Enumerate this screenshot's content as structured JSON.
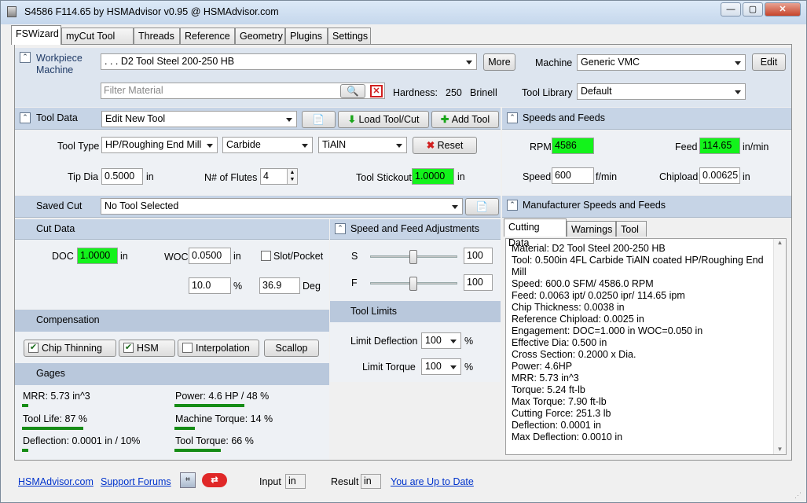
{
  "window": {
    "title": "S4586 F114.65 by HSMAdvisor v0.95 @ HSMAdvisor.com",
    "minimize": "—",
    "maximize": "▢",
    "close": "✕"
  },
  "tabs": [
    "FSWizard",
    "myCut Tool DB",
    "Threads",
    "Reference",
    "Geometry",
    "Plugins",
    "Settings"
  ],
  "workpiece": {
    "label1": "Workpiece",
    "label2": "Machine",
    "material": ". . . D2 Tool Steel 200-250 HB",
    "more": "More",
    "machine_label": "Machine",
    "machine": "Generic VMC",
    "edit": "Edit",
    "filter_placeholder": "Filter Material",
    "hardness_label": "Hardness:",
    "hardness_value": "250",
    "hardness_unit": "Brinell",
    "tool_library_label": "Tool Library",
    "tool_library": "Default"
  },
  "tool_data": {
    "header": "Tool Data",
    "tool_select": "Edit New Tool",
    "load": "Load Tool/Cut",
    "add": "Add Tool",
    "tool_type_label": "Tool Type",
    "tool_type": "HP/Roughing End Mill",
    "material": "Carbide",
    "coating": "TiAlN",
    "reset": "Reset",
    "tip_dia_label": "Tip Dia",
    "tip_dia": "0.5000",
    "tip_unit": "in",
    "flutes_label": "N# of Flutes",
    "flutes": "4",
    "stickout_label": "Tool Stickout",
    "stickout": "1.0000",
    "stickout_unit": "in"
  },
  "speeds": {
    "header": "Speeds and Feeds",
    "rpm_label": "RPM",
    "rpm": "4586",
    "feed_label": "Feed",
    "feed": "114.65",
    "feed_unit": "in/min",
    "speed_label": "Speed",
    "speed": "600",
    "speed_unit": "f/min",
    "chipload_label": "Chipload",
    "chipload": "0.00625",
    "chipload_unit": "in"
  },
  "saved_cut": {
    "label": "Saved Cut",
    "value": "No Tool Selected"
  },
  "manufacturer": {
    "header": "Manufacturer Speeds and Feeds"
  },
  "cut_data": {
    "header": "Cut Data",
    "doc_label": "DOC",
    "doc": "1.0000",
    "doc_unit": "in",
    "woc_label": "WOC",
    "woc": "0.0500",
    "woc_unit": "in",
    "slot_label": "Slot/Pocket",
    "pct": "10.0",
    "pct_unit": "%",
    "deg": "36.9",
    "deg_unit": "Deg"
  },
  "adjust": {
    "header": "Speed and Feed Adjustments",
    "s_label": "S",
    "s_value": "100",
    "s_level": 0.5,
    "f_label": "F",
    "f_value": "100",
    "f_level": 0.5
  },
  "limits": {
    "header": "Tool Limits",
    "defl_label": "Limit Deflection",
    "defl": "100",
    "defl_unit": "%",
    "torque_label": "Limit Torque",
    "torque": "100",
    "torque_unit": "%"
  },
  "compensation": {
    "header": "Compensation",
    "chip_thinning": "Chip Thinning",
    "hsm": "HSM",
    "interpolation": "Interpolation",
    "scallop": "Scallop"
  },
  "gages": {
    "header": "Gages",
    "mrr": "MRR: 5.73 in^3",
    "mrr_level": 0.06,
    "power": "Power: 4.6 HP / 48 %",
    "power_level": 0.48,
    "tool_life": "Tool Life: 87 %",
    "tool_life_level": 0.87,
    "machine_torque": "Machine Torque: 14 %",
    "machine_torque_level": 0.14,
    "deflection": "Deflection: 0.0001 in / 10%",
    "deflection_level": 0.1,
    "tool_torque": "Tool Torque: 66 %",
    "tool_torque_level": 0.66
  },
  "info_tabs": [
    "Cutting Data",
    "Warnings",
    "Tool"
  ],
  "cutting_data": [
    "Material: D2 Tool Steel 200-250 HB",
    "Tool: 0.500in 4FL Carbide TiAlN coated HP/Roughing End",
    "Mill",
    "Speed: 600.0 SFM/ 4586.0 RPM",
    "Feed: 0.0063 ipt/ 0.0250 ipr/ 114.65 ipm",
    "Chip Thickness: 0.0038 in",
    "Reference Chipload: 0.0025 in",
    "Engagement:  DOC=1.000 in   WOC=0.050 in",
    "Effective Dia: 0.500 in",
    "Cross Section: 0.2000 x Dia.",
    "Power: 4.6HP",
    "MRR: 5.73 in^3",
    "Torque: 5.24 ft-lb",
    "Max Torque: 7.90 ft-lb",
    "Cutting Force: 251.3 lb",
    "Deflection: 0.0001 in",
    "Max Deflection: 0.0010 in"
  ],
  "footer": {
    "site": "HSMAdvisor.com",
    "forums": "Support Forums",
    "input_label": "Input",
    "input_unit": "in",
    "result_label": "Result",
    "result_unit": "in",
    "update": "You are Up to Date"
  },
  "colors": {
    "accent_green": "#13f31b",
    "header_blue": "#c6d4e6",
    "link_blue": "#0033cc"
  }
}
